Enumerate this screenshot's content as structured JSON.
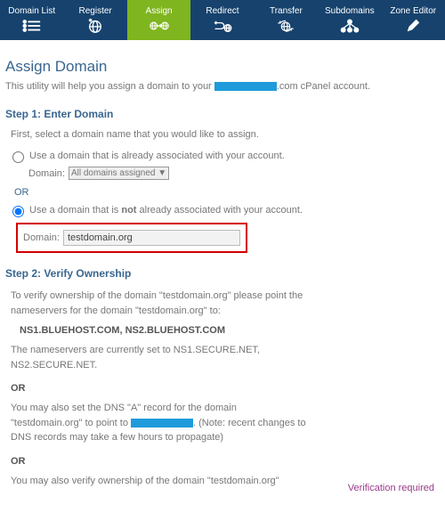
{
  "nav": {
    "items": [
      {
        "label": "Domain List"
      },
      {
        "label": "Register"
      },
      {
        "label": "Assign"
      },
      {
        "label": "Redirect"
      },
      {
        "label": "Transfer"
      },
      {
        "label": "Subdomains"
      },
      {
        "label": "Zone Editor"
      }
    ]
  },
  "page": {
    "title": "Assign Domain",
    "intro_before": "This utility will help you assign a domain to your ",
    "intro_after": ".com cPanel account."
  },
  "step1": {
    "heading": "Step 1: Enter Domain",
    "sub": "First, select a domain name that you would like to assign.",
    "optA": "Use a domain that is already associated with your account.",
    "domain_label": "Domain:",
    "domain_select": "All domains assigned ▼",
    "or": "OR",
    "optB_before": "Use a domain that is ",
    "optB_bold": "not",
    "optB_after": " already associated with your account.",
    "domain_input_value": "testdomain.org"
  },
  "step2": {
    "heading": "Step 2: Verify Ownership",
    "p1": "To verify ownership of the domain \"testdomain.org\" please point the nameservers for the domain \"testdomain.org\" to:",
    "nameservers": "NS1.BLUEHOST.COM, NS2.BLUEHOST.COM",
    "p2": "The nameservers are currently set to NS1.SECURE.NET, NS2.SECURE.NET.",
    "or": "OR",
    "p3a": "You may also set the DNS \"A\" record for the domain \"testdomain.org\" to point to ",
    "p3b": ". (Note: recent changes to DNS records may take a few hours to propagate)",
    "p4": "You may also verify ownership of the domain \"testdomain.org\"",
    "verification": "Verification required"
  }
}
